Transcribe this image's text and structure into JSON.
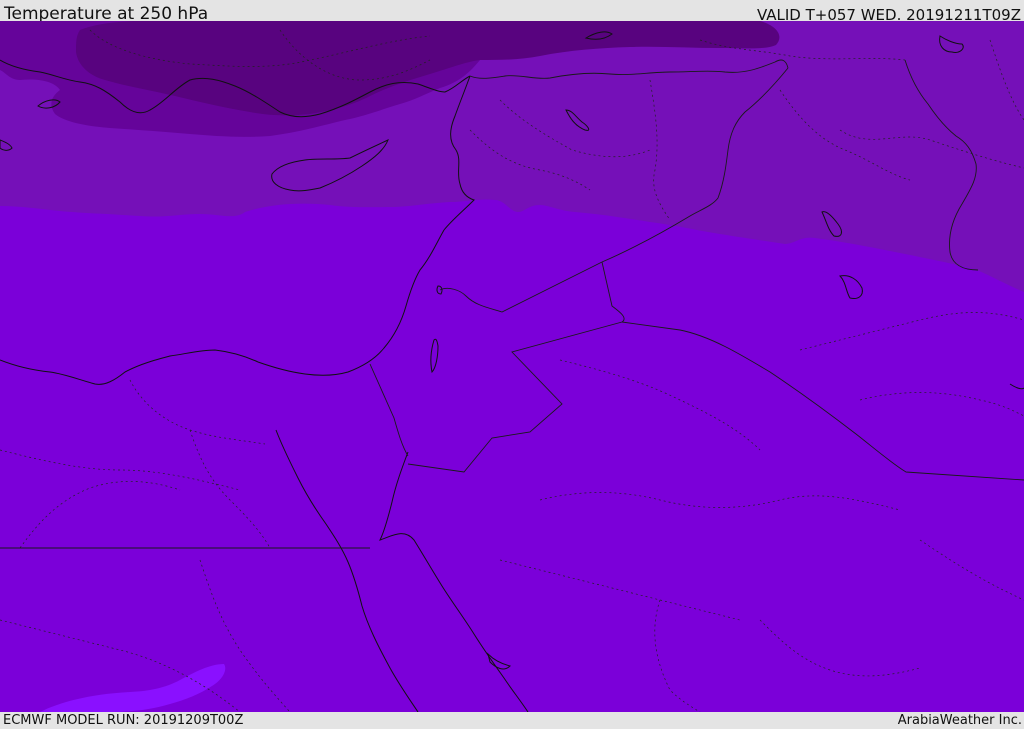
{
  "header": {
    "title": "Temperature at 250 hPa",
    "valid_time": "VALID T+057 WED. 20191211T09Z"
  },
  "footer": {
    "model_run": "ECMWF MODEL RUN: 20191209T00Z",
    "credit": "ArabiaWeather Inc."
  },
  "colors": {
    "frame_background": "#e4e4e4",
    "temperature_band_base": "#7b00d9",
    "temperature_band_mid": "#7510b8",
    "temperature_band_cold": "#65049a",
    "temperature_band_coldest": "#58037f",
    "temperature_band_warm": "#8a10ff",
    "coastline": "#111111",
    "border": "#1a1a1a"
  }
}
